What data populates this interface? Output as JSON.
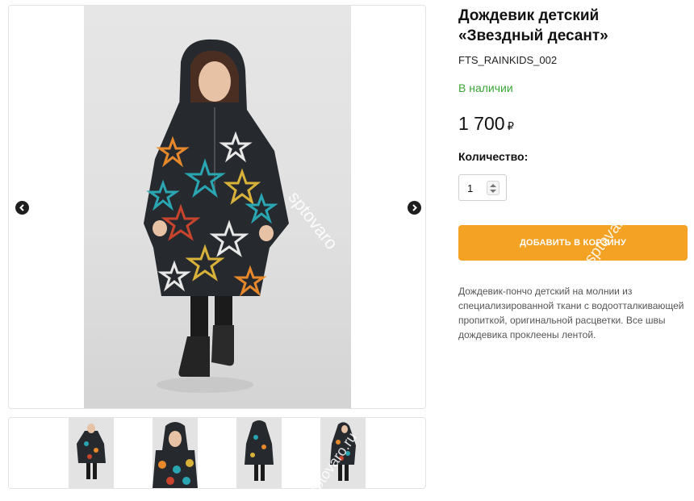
{
  "product": {
    "title": "Дождевик детский «Звездный десант»",
    "sku": "FTS_RAINKIDS_002",
    "availability": "В наличии",
    "price": "1 700",
    "currency": "₽",
    "quantity_label": "Количество:",
    "quantity_value": "1",
    "add_to_cart_label": "ДОБАВИТЬ В КОРЗИНУ",
    "description": "Дождевик-пончо детский на молнии из специализированной ткани с водоотталкивающей пропиткой, оригинальной расцветки. Все швы дождевика проклеены лентой."
  },
  "gallery": {
    "prev_icon": "chevron-left-icon",
    "next_icon": "chevron-right-icon",
    "thumbnails": [
      "front-full",
      "hood-closeup",
      "back-view",
      "side-view"
    ]
  },
  "watermark": {
    "text_main": "sptovaro",
    "text_button": "sptovaro",
    "text_thumbs": "sptovaro.ru"
  },
  "colors": {
    "accent": "#f4a223",
    "in_stock": "#3aa635",
    "poncho": "#262a2f",
    "star_teal": "#2aa6b3",
    "star_orange": "#e7892b",
    "star_red": "#c8442c",
    "star_yellow": "#d9b23a",
    "star_white": "#e8e8e8"
  }
}
